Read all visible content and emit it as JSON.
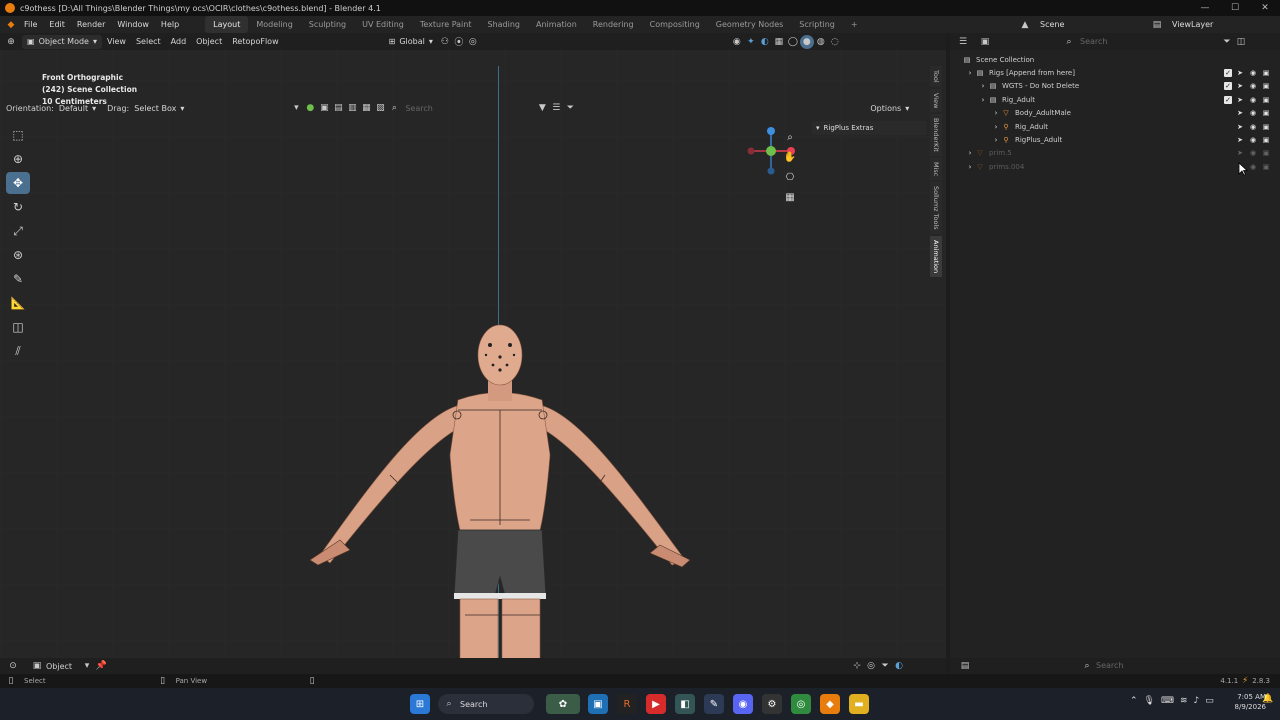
{
  "window": {
    "title": "c9othess [D:\\All Things\\Blender Things\\my ocs\\OCIR\\clothes\\c9othess.blend] - Blender 4.1",
    "controls": {
      "minimize": "—",
      "maximize": "☐",
      "close": "✕"
    }
  },
  "menubar": {
    "items": [
      "File",
      "Edit",
      "Render",
      "Window",
      "Help"
    ],
    "workspaces": [
      "Layout",
      "Modeling",
      "Sculpting",
      "UV Editing",
      "Texture Paint",
      "Shading",
      "Animation",
      "Rendering",
      "Compositing",
      "Geometry Nodes",
      "Scripting"
    ],
    "active_workspace": "Layout",
    "add_tab": "+",
    "scene_label": "Scene",
    "view_layer_label": "ViewLayer"
  },
  "viewport_header": {
    "mode": "Object Mode",
    "menus": [
      "View",
      "Select",
      "Add",
      "Object",
      "RetopoFlow"
    ],
    "transform_orientation": "Global"
  },
  "tool_header": {
    "orientation_label": "Orientation:",
    "orientation_value": "Default",
    "drag_label": "Drag:",
    "drag_value": "Select Box",
    "search_placeholder": "Search",
    "options_label": "Options"
  },
  "viewport": {
    "view_name": "Front Orthographic",
    "collection_info": "(242) Scene Collection",
    "scale_info": "10 Centimeters",
    "panel_title": "RigPlus Extras",
    "side_tabs": [
      "Tool",
      "View",
      "BlenderKit",
      "Misc",
      "Sollumz Tools",
      "Animation"
    ],
    "active_side_tab": "Animation",
    "gizmo_colors": {
      "x": "#e84152",
      "y": "#6ec04a",
      "z": "#3d8fe0"
    }
  },
  "outliner": {
    "search_placeholder": "Search",
    "rows": [
      {
        "label": "Scene Collection",
        "indent": 0,
        "dim": false,
        "icon": "collection-icon"
      },
      {
        "label": "Rigs [Append from here]",
        "indent": 1,
        "dim": false,
        "icon": "collection-icon"
      },
      {
        "label": "WGTS - Do Not Delete",
        "indent": 2,
        "dim": false,
        "icon": "collection-icon"
      },
      {
        "label": "Rig_Adult",
        "indent": 2,
        "dim": false,
        "icon": "collection-icon"
      },
      {
        "label": "Body_AdultMale",
        "indent": 3,
        "dim": false,
        "icon": "object-icon"
      },
      {
        "label": "Rig_Adult",
        "indent": 3,
        "dim": false,
        "icon": "armature-icon"
      },
      {
        "label": "RigPlus_Adult",
        "indent": 3,
        "dim": false,
        "icon": "armature-icon"
      },
      {
        "label": "prim.5",
        "indent": 1,
        "dim": true,
        "icon": "object-icon"
      },
      {
        "label": "prims.004",
        "indent": 1,
        "dim": true,
        "icon": "object-icon"
      }
    ]
  },
  "bottom": {
    "mode": "Object",
    "search_placeholder": "Search"
  },
  "statusbar": {
    "select": "Select",
    "pan_view": "Pan View",
    "version": "4.1.1",
    "extra": "2.8.3"
  },
  "taskbar": {
    "search": "Search",
    "time": "7:05 AM",
    "date": "8/9/2026"
  }
}
